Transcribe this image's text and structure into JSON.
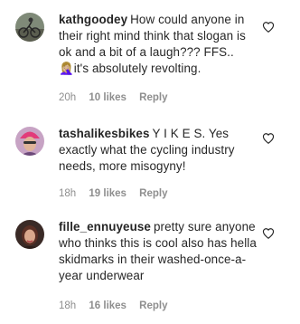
{
  "comments": [
    {
      "username": "kathgoodey",
      "text": "How could anyone in their right mind think that slogan is ok and a bit of a laugh??? FFS.. 🤦🏼‍♀️it's absolutely revolting.",
      "time": "20h",
      "likes": "10 likes",
      "reply": "Reply",
      "avatar_icon": "cyclist-photo-avatar"
    },
    {
      "username": "tashalikesbikes",
      "text": "Y I K E S. Yes exactly what the cycling industry needs, more misogyny!",
      "time": "18h",
      "likes": "19 likes",
      "reply": "Reply",
      "avatar_icon": "woman-helmet-avatar"
    },
    {
      "username": "fille_ennuyeuse",
      "text": "pretty sure anyone who thinks this is cool also has hella skidmarks in their washed-once-a-year underwear",
      "time": "18h",
      "likes": "16 likes",
      "reply": "Reply",
      "avatar_icon": "woman-portrait-avatar"
    }
  ],
  "icons": {
    "like": "heart-outline-icon"
  },
  "colors": {
    "text": "#262626",
    "meta": "#8e8e8e"
  }
}
